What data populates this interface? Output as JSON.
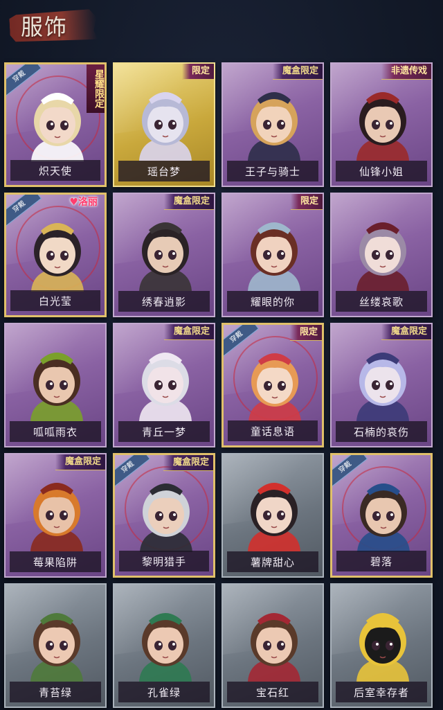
{
  "header": {
    "title": "服饰"
  },
  "colors": {
    "worn_ring": "#c8283c",
    "badge_gold": "#f0d98a",
    "lolita_pink": "#ff3d6e"
  },
  "worn_label": "穿戴",
  "cards": [
    {
      "name": "炽天使",
      "badge": "星耀限定",
      "worn": true,
      "frame": "pink",
      "skin": "#f2d9c9",
      "hair": "#e8d7a8",
      "hat": "#ffffff"
    },
    {
      "name": "瑶台梦",
      "badge": "限定",
      "worn": false,
      "frame": "gold",
      "skin": "#e6e3ef",
      "hair": "#b7b9d6",
      "hat": "#d9d4ee"
    },
    {
      "name": "王子与骑士",
      "badge": "魔盒限定",
      "worn": false,
      "frame": "purple",
      "skin": "#f1d3bb",
      "hair": "#d6a35b",
      "hat": "#2f2f4a"
    },
    {
      "name": "仙锋小姐",
      "badge": "非遗传戏",
      "worn": false,
      "frame": "purple",
      "skin": "#e9c9b4",
      "hair": "#2a1c1f",
      "hat": "#9a2a2a"
    },
    {
      "name": "白光莹",
      "badge": "洛丽",
      "worn": true,
      "frame": "purple",
      "skin": "#f1d9c6",
      "hair": "#2b2228",
      "hat": "#d9b457"
    },
    {
      "name": "绣春逍影",
      "badge": "魔盒限定",
      "worn": false,
      "frame": "purple",
      "skin": "#e7cbb6",
      "hair": "#2b2326",
      "hat": "#3a3436"
    },
    {
      "name": "耀眼的你",
      "badge": "限定",
      "worn": false,
      "frame": "purple",
      "skin": "#f0d2c0",
      "hair": "#6a2f25",
      "hat": "#9eb7cc"
    },
    {
      "name": "丝缕哀歌",
      "badge": "",
      "worn": false,
      "frame": "purple",
      "skin": "#f0ddd8",
      "hair": "#9b8aa6",
      "hat": "#6a1f2c"
    },
    {
      "name": "呱呱雨衣",
      "badge": "",
      "worn": false,
      "frame": "purple",
      "skin": "#e9c7af",
      "hair": "#4a2e22",
      "hat": "#7aa02b"
    },
    {
      "name": "青丘一梦",
      "badge": "魔盒限定",
      "worn": false,
      "frame": "purple",
      "skin": "#f1e3e8",
      "hair": "#dcdce6",
      "hat": "#efe8f2"
    },
    {
      "name": "童话息语",
      "badge": "限定",
      "worn": true,
      "frame": "purple",
      "skin": "#f4d9c6",
      "hair": "#e79a55",
      "hat": "#cf3c46"
    },
    {
      "name": "石楠的哀伤",
      "badge": "魔盒限定",
      "worn": false,
      "frame": "purple",
      "skin": "#ece3ec",
      "hair": "#b7b8e8",
      "hat": "#3c3b78"
    },
    {
      "name": "莓果陷阱",
      "badge": "魔盒限定",
      "worn": false,
      "frame": "purple",
      "skin": "#e8c2a8",
      "hair": "#d87a2c",
      "hat": "#8a2a1e"
    },
    {
      "name": "黎明猎手",
      "badge": "魔盒限定",
      "worn": true,
      "frame": "purple",
      "skin": "#ebcfbc",
      "hair": "#cfd2d8",
      "hat": "#2b2c34"
    },
    {
      "name": "薯牌甜心",
      "badge": "",
      "worn": false,
      "frame": "grey",
      "skin": "#f0d6c7",
      "hair": "#2a2125",
      "hat": "#d2302c"
    },
    {
      "name": "碧落",
      "badge": "",
      "worn": true,
      "frame": "purple",
      "skin": "#e8c7b0",
      "hair": "#3a2a24",
      "hat": "#274e8a"
    },
    {
      "name": "青苔绿",
      "badge": "",
      "worn": false,
      "frame": "grey",
      "skin": "#ecc9b3",
      "hair": "#5a3a2a",
      "hat": "#4f7a3b"
    },
    {
      "name": "孔雀绿",
      "badge": "",
      "worn": false,
      "frame": "grey",
      "skin": "#ecc9b3",
      "hair": "#5a3a2a",
      "hat": "#2f7a52"
    },
    {
      "name": "宝石红",
      "badge": "",
      "worn": false,
      "frame": "grey",
      "skin": "#ecc9b3",
      "hair": "#5a3a2a",
      "hat": "#a32834"
    },
    {
      "name": "后室幸存者",
      "badge": "",
      "worn": false,
      "frame": "grey",
      "skin": "#1b1b1b",
      "hair": "#e8c33a",
      "hat": "#e8c33a"
    }
  ]
}
